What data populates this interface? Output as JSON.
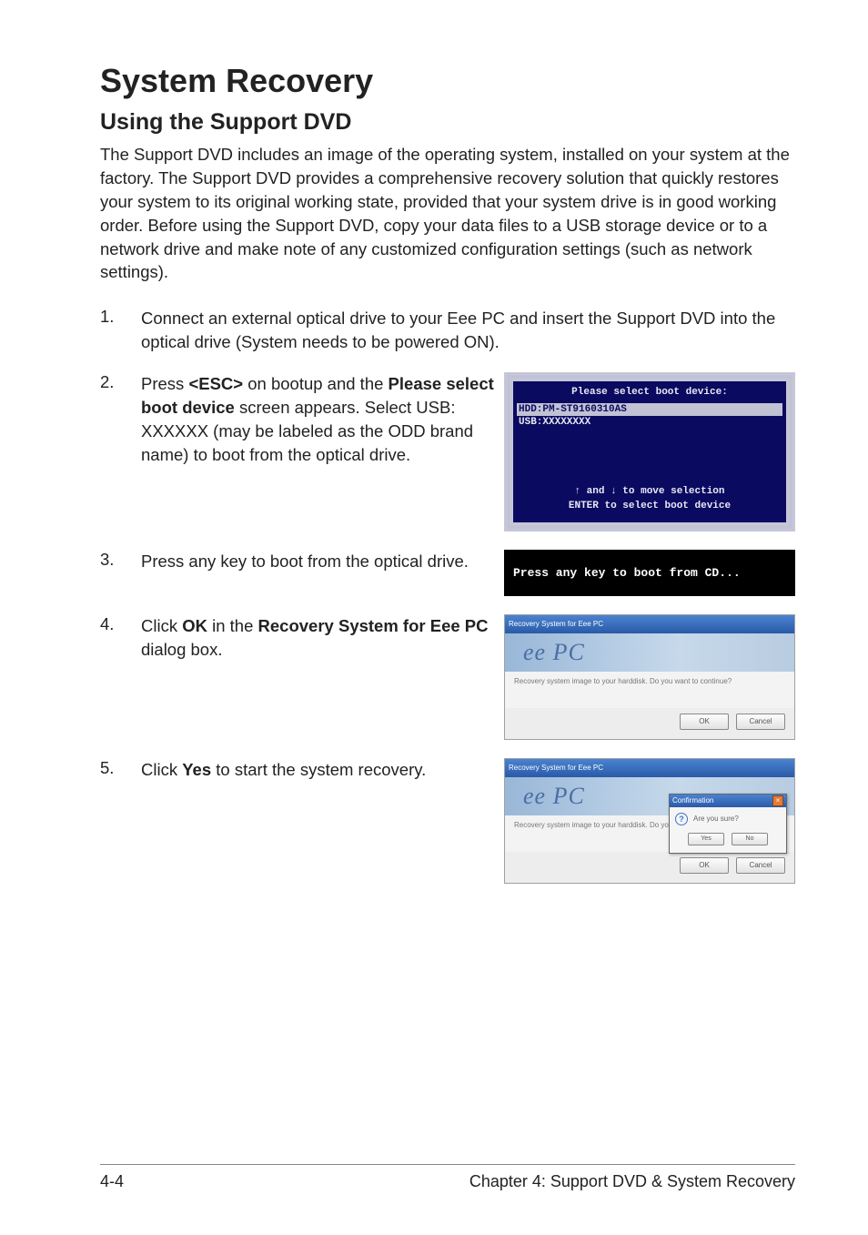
{
  "title": "System Recovery",
  "subtitle": "Using the Support DVD",
  "intro": "The Support DVD includes an image of the operating system, installed on your system at the factory. The Support DVD provides a comprehensive recovery solution that quickly restores your system to its original working state, provided that your system drive is in good working order. Before using the Support DVD, copy your data files to a USB storage device or to a network drive and make note of any customized configuration settings (such as network settings).",
  "steps": {
    "s1_num": "1.",
    "s1_text": "Connect an external optical drive to your Eee PC and insert the Support DVD into the optical drive (System needs to be powered ON).",
    "s2_num": "2.",
    "s2_pre": "Press ",
    "s2_key": "<ESC>",
    "s2_mid": " on bootup and the ",
    "s2_bold": "Please select boot device",
    "s2_post": " screen appears. Select USB: XXXXXX (may be labeled as the ODD brand name) to boot from the optical drive.",
    "s3_num": "3.",
    "s3_text": "Press any key to boot from the optical drive.",
    "s4_num": "4.",
    "s4_pre": "Click ",
    "s4_b1": "OK",
    "s4_mid": " in the ",
    "s4_b2": "Recovery System for Eee PC",
    "s4_post": " dialog box.",
    "s5_num": "5.",
    "s5_pre": "Click ",
    "s5_b1": "Yes",
    "s5_post": " to start the system recovery."
  },
  "bios": {
    "title": "Please select boot device:",
    "item1": "HDD:PM-ST9160310AS",
    "item2": "USB:XXXXXXXX",
    "hint1": "↑ and ↓ to move selection",
    "hint2": "ENTER to select boot device"
  },
  "bootcd": "Press any key to boot from CD...",
  "dlg1": {
    "title": "Recovery System for Eee PC",
    "logo": "ee PC",
    "body": "Recovery system image to your harddisk. Do you want to continue?",
    "ok": "OK",
    "cancel": "Cancel"
  },
  "dlg2": {
    "title": "Recovery System for Eee PC",
    "logo": "ee PC",
    "body": "Recovery system image to your harddisk. Do you want to continue?",
    "ov_title": "Confirmation",
    "ov_body": "Are you sure?",
    "yes": "Yes",
    "no": "No",
    "ok": "OK",
    "cancel": "Cancel"
  },
  "footer": {
    "left": "4-4",
    "right": "Chapter 4: Support DVD & System Recovery"
  }
}
